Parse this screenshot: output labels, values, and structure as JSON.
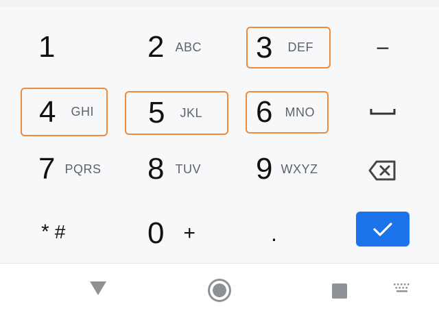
{
  "keypad": {
    "keys": [
      {
        "digit": "1",
        "letters": ""
      },
      {
        "digit": "2",
        "letters": "ABC"
      },
      {
        "digit": "3",
        "letters": "DEF"
      },
      {
        "digit": "4",
        "letters": "GHI"
      },
      {
        "digit": "5",
        "letters": "JKL"
      },
      {
        "digit": "6",
        "letters": "MNO"
      },
      {
        "digit": "7",
        "letters": "PQRS"
      },
      {
        "digit": "8",
        "letters": "TUV"
      },
      {
        "digit": "9",
        "letters": "WXYZ"
      },
      {
        "digit": "*",
        "letters": "#"
      },
      {
        "digit": "0",
        "letters": "+"
      },
      {
        "digit": ".",
        "letters": ""
      }
    ],
    "minus_label": "–"
  },
  "colors": {
    "highlight": "#f08a3a",
    "accent": "#1a73e8"
  },
  "icons": {
    "space": "space-bar-icon",
    "backspace": "backspace-icon",
    "confirm": "checkmark-icon",
    "back": "nav-back-icon",
    "home": "nav-home-icon",
    "recents": "nav-recents-icon",
    "keyboard": "keyboard-switch-icon"
  }
}
